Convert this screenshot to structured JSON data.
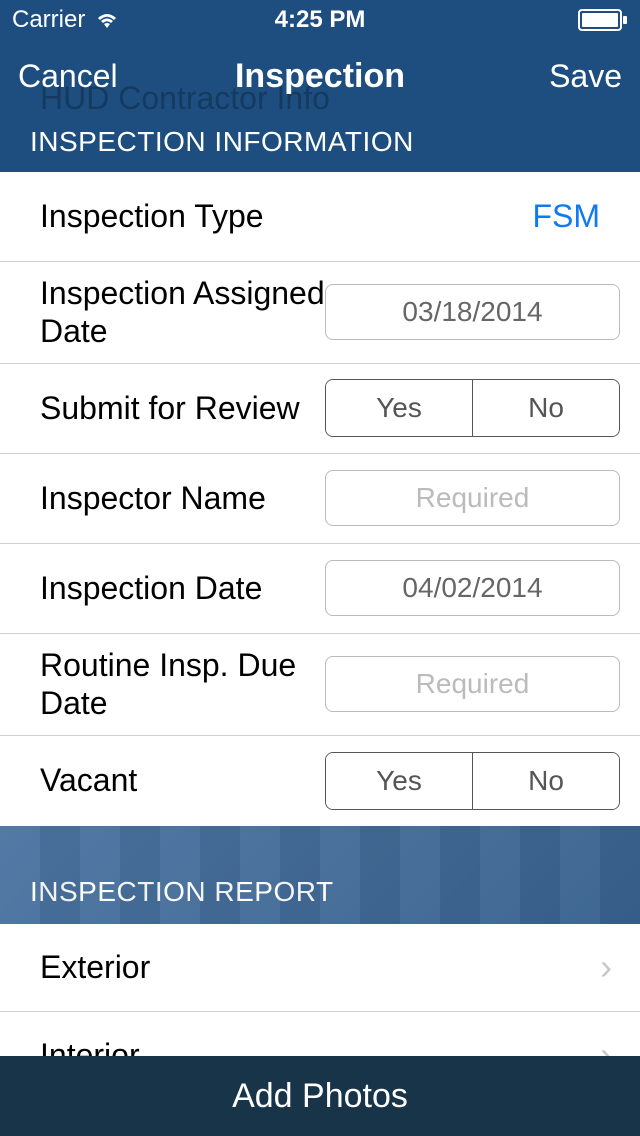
{
  "status_bar": {
    "carrier": "Carrier",
    "time": "4:25 PM"
  },
  "nav": {
    "cancel": "Cancel",
    "title": "Inspection",
    "save": "Save"
  },
  "section1": {
    "header": "INSPECTION INFORMATION",
    "inspection_type": {
      "label": "Inspection Type",
      "value": "FSM"
    },
    "assigned_date": {
      "label": "Inspection Assigned Date",
      "value": "03/18/2014"
    },
    "submit_review": {
      "label": "Submit for Review",
      "yes": "Yes",
      "no": "No"
    },
    "inspector_name": {
      "label": "Inspector Name",
      "placeholder": "Required"
    },
    "inspection_date": {
      "label": "Inspection Date",
      "value": "04/02/2014"
    },
    "routine_due": {
      "label": "Routine Insp. Due Date",
      "placeholder": "Required"
    },
    "vacant": {
      "label": "Vacant",
      "yes": "Yes",
      "no": "No"
    }
  },
  "section2": {
    "header": "INSPECTION REPORT",
    "items": [
      {
        "label": "Exterior"
      },
      {
        "label": "Interior"
      }
    ]
  },
  "bottom_bar": {
    "label": "Add Photos"
  },
  "ghost": "HUD Contractor Info"
}
